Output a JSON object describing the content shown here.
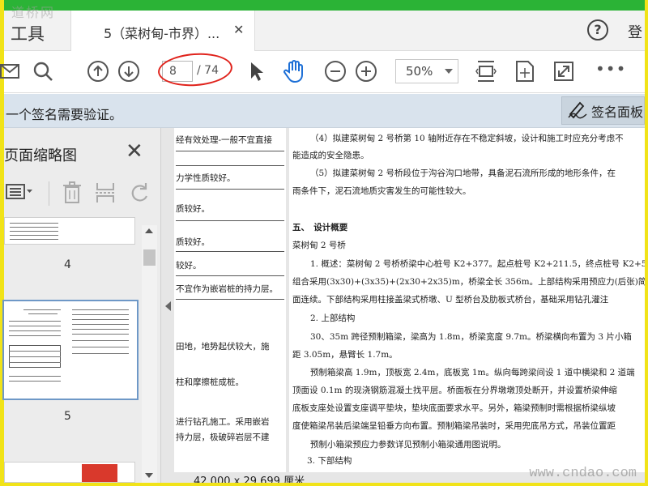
{
  "watermark": {
    "top_left": "道桥网",
    "bottom_right": "www.cndao.com"
  },
  "tabs": {
    "tools_label": "工具",
    "document_title": "5（菜树甸-市界）...",
    "close_glyph": "✕",
    "sign_in": "登",
    "help_glyph": "?"
  },
  "toolbar": {
    "current_page": "8",
    "page_total": "/ 74",
    "zoom": "50%",
    "more": "•••",
    "icons": [
      "envelope-icon",
      "search-icon",
      "page-up-icon",
      "page-down-icon",
      "select-arrow-icon",
      "hand-icon",
      "zoom-out-icon",
      "zoom-in-icon",
      "fit-page-icon",
      "fit-width-icon",
      "fullscreen-icon",
      "more-icon"
    ]
  },
  "signature_bar": {
    "message": "一个签名需要验证。",
    "button_label": "签名面板"
  },
  "thumbnails": {
    "title": "页面缩略图",
    "close_glyph": "✕",
    "pages": [
      {
        "number": "4"
      },
      {
        "number": "5"
      }
    ]
  },
  "document": {
    "left_page_lines": [
      "经有效处理-一般不宜直接",
      "力学性质较好。",
      "质较好。",
      "质较好。",
      "较好。",
      "不宜作为嵌岩桩的持力层。",
      "田地，地势起伏较大，施",
      "柱和摩擦桩成桩。",
      "进行钻孔施工。采用嵌岩",
      "持力层，极破碎岩层不建"
    ],
    "right_page_lines": [
      "（4）拟建菜树甸 2 号桥第 10 轴附近存在不稳定斜坡，设计和施工时应充分考虑不",
      "能造成的安全隐患。",
      "（5）拟建菜树甸 2 号桥段位于沟谷沟口地带，具备泥石流所形成的地形条件，在",
      "雨条件下，泥石流地质灾害发生的可能性较大。",
      "五、　设计概要",
      "菜树甸 2 号桥",
      "1. 概述：菜树甸 2 号桥桥梁中心桩号 K2+377。起点桩号 K2+211.5，终点桩号 K2+5",
      "组合采用(3x30)+(3x35)+(2x30+2x35)m，桥梁全长 356m。上部结构采用预应力(后张)简",
      "面连续。下部结构采用柱接盖梁式桥墩、U 型桥台及肋板式桥台，基础采用钻孔灌注",
      "2. 上部结构",
      "30、35m 跨径预制箱梁，梁高为 1.8m，桥梁宽度 9.7m。桥梁横向布置为 3 片小箱",
      "距 3.05m，悬臂长 1.7m。",
      "预制箱梁高 1.9m，顶板宽 2.4m，底板宽 1m。纵向每跨梁间设 1 道中横梁和 2 道端",
      "顶面设 0.1m 的现浇钢筋混凝土找平层。桥面板在分界墩墩顶处断开，并设置桥梁伸缩",
      "底板支座处设置支座调平垫块，垫块底面要求水平。另外，箱梁预制时需根据桥梁纵坡",
      "度使箱梁吊装后梁端呈铅垂方向布置。预制箱梁吊装时，采用兜底吊方式，吊装位置距",
      "预制小箱梁预应力参数详见预制小箱梁通用图说明。",
      "3. 下部结构"
    ],
    "page_size": "42.000 x 29.699 厘米"
  },
  "colors": {
    "frame_green": "#2bb336",
    "frame_yellow": "#f1e318",
    "annotation_red": "#e0231c",
    "banner_blue": "#d9e3ed"
  }
}
